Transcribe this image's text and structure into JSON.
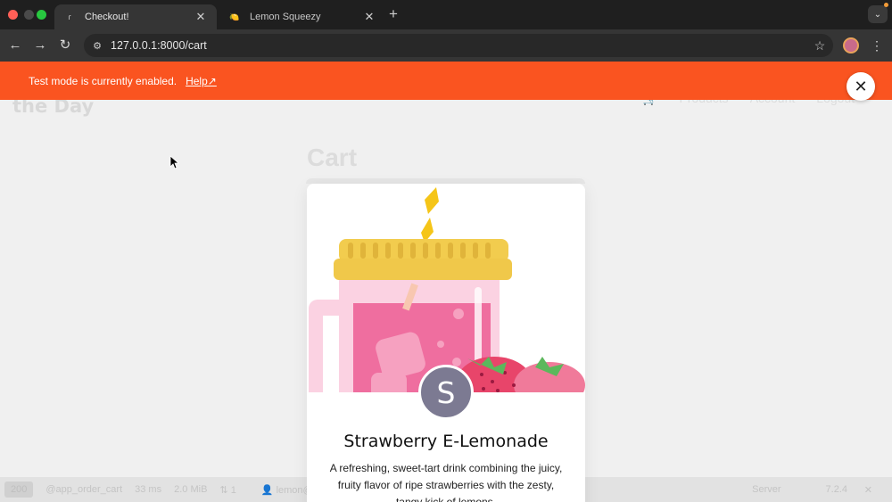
{
  "browser": {
    "tabs": [
      {
        "title": "Checkout!",
        "favicon": "lemon-squeezy-favicon",
        "active": true
      },
      {
        "title": "Lemon Squeezy",
        "favicon": "lemon-favicon",
        "active": false
      }
    ],
    "url": "127.0.0.1:8000/cart"
  },
  "banner": {
    "text": "Test mode is currently enabled.",
    "help_label": "Help↗"
  },
  "background_app": {
    "logo": "the Day",
    "nav": [
      "Products",
      "Account",
      "Logout"
    ],
    "page_title": "Cart"
  },
  "dev_toolbar": {
    "status": "200",
    "route": "@app_order_cart",
    "time": "33 ms",
    "memory": "2.0 MiB",
    "queries": "1",
    "user": "lemon@examp",
    "server": "Server",
    "version": "7.2.4"
  },
  "product": {
    "store_initial": "S",
    "name": "Strawberry E-Lemonade",
    "description": "A refreshing, sweet-tart drink combining the juicy, fruity flavor of ripe strawberries with the zesty, tangy kick of lemons."
  },
  "colors": {
    "banner": "#fa5420",
    "avatar": "#7c7a92"
  }
}
